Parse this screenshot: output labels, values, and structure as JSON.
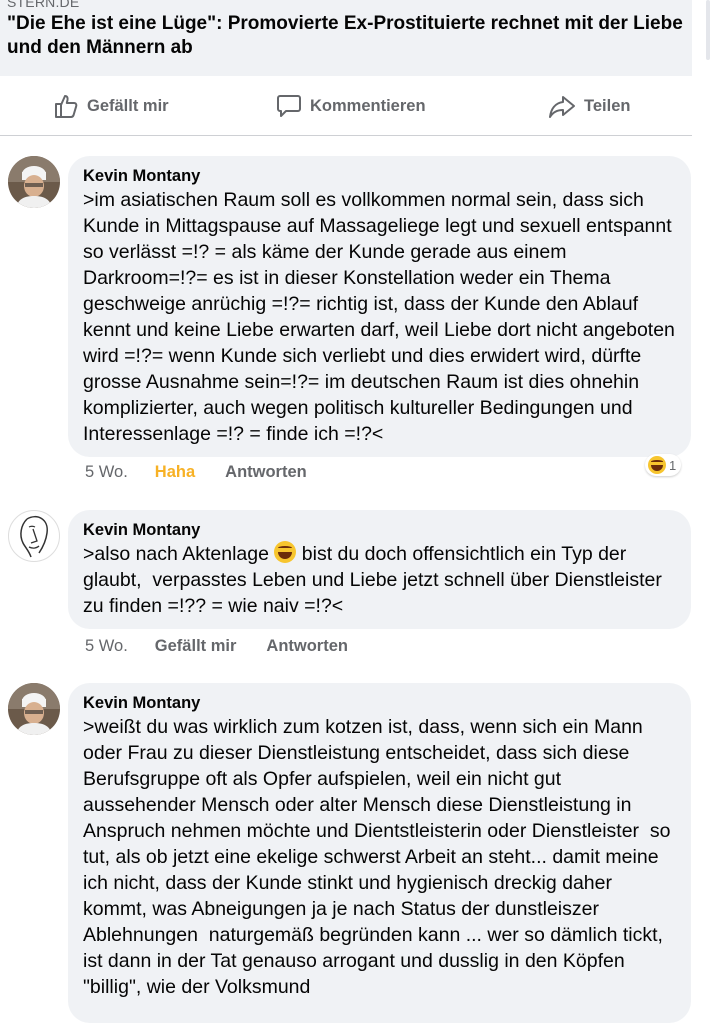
{
  "link_preview": {
    "source": "STERN.DE",
    "headline": "\"Die Ehe ist eine Lüge\": Promovierte Ex-Prostituierte rechnet mit der Liebe und den Männern ab"
  },
  "actions": {
    "like": "Gefällt mir",
    "comment": "Kommentieren",
    "share": "Teilen"
  },
  "comments": [
    {
      "author": "Kevin Montany",
      "text": ">im asiatischen Raum soll es vollkommen normal sein, dass sich Kunde in Mittagspause auf Massageliege legt und sexuell entspannt so verlässt =!? = als käme der Kunde gerade aus einem Darkroom=!?= es ist in dieser Konstellation weder ein Thema geschweige anrüchig =!?= richtig ist, dass der Kunde den Ablauf kennt und keine Liebe erwarten darf, weil Liebe dort nicht angeboten wird =!?= wenn Kunde sich verliebt und dies erwidert wird, dürfte grosse Ausnahme sein=!?= im deutschen Raum ist dies ohnehin komplizierter, auch wegen politisch kultureller Bedingungen und Interessenlage =!? = finde ich =!?<",
      "time": "5 Wo.",
      "like_label": "Haha",
      "reply_label": "Antworten",
      "reaction_icon": "haha-emoji",
      "reaction_count": "1"
    },
    {
      "author": "Kevin Montany",
      "text_before_emoji": ">also nach Aktenlage ",
      "emoji": "laughing-emoji",
      "text_after_emoji": " bist du doch offensichtlich ein Typ der glaubt,  verpasstes Leben und Liebe jetzt schnell über Dienstleister  zu finden =!?? = wie naiv =!?<",
      "time": "5 Wo.",
      "like_label": "Gefällt mir",
      "reply_label": "Antworten"
    },
    {
      "author": "Kevin Montany",
      "text": ">weißt du was wirklich zum kotzen ist, dass, wenn sich ein Mann oder Frau zu dieser Dienstleistung entscheidet, dass sich diese Berufsgruppe oft als Opfer aufspielen, weil ein nicht gut aussehender Mensch oder alter Mensch diese Dienstleistung in Anspruch nehmen möchte und Dientstleisterin oder Dienstleister  so tut, als ob jetzt eine ekelige schwerst Arbeit an steht... damit meine ich nicht, dass der Kunde stinkt und hygienisch dreckig daher kommt, was Abneigungen ja je nach Status der dunstleiszer  Ablehnungen  naturgemäß begründen kann ... wer so dämlich tickt, ist dann in der Tat genauso arrogant und dusslig in den Köpfen \"billig\", wie der Volksmund"
    }
  ],
  "colors": {
    "bubble": "#f0f2f5",
    "meta_text": "#65676b",
    "haha_active": "#f7b125"
  }
}
